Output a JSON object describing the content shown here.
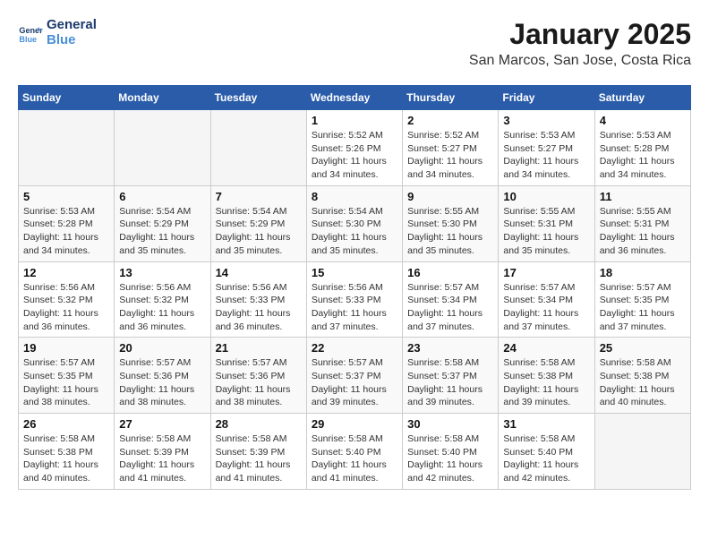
{
  "logo": {
    "line1": "General",
    "line2": "Blue"
  },
  "title": "January 2025",
  "subtitle": "San Marcos, San Jose, Costa Rica",
  "days_of_week": [
    "Sunday",
    "Monday",
    "Tuesday",
    "Wednesday",
    "Thursday",
    "Friday",
    "Saturday"
  ],
  "weeks": [
    [
      {
        "day": "",
        "sunrise": "",
        "sunset": "",
        "daylight": ""
      },
      {
        "day": "",
        "sunrise": "",
        "sunset": "",
        "daylight": ""
      },
      {
        "day": "",
        "sunrise": "",
        "sunset": "",
        "daylight": ""
      },
      {
        "day": "1",
        "sunrise": "Sunrise: 5:52 AM",
        "sunset": "Sunset: 5:26 PM",
        "daylight": "Daylight: 11 hours and 34 minutes."
      },
      {
        "day": "2",
        "sunrise": "Sunrise: 5:52 AM",
        "sunset": "Sunset: 5:27 PM",
        "daylight": "Daylight: 11 hours and 34 minutes."
      },
      {
        "day": "3",
        "sunrise": "Sunrise: 5:53 AM",
        "sunset": "Sunset: 5:27 PM",
        "daylight": "Daylight: 11 hours and 34 minutes."
      },
      {
        "day": "4",
        "sunrise": "Sunrise: 5:53 AM",
        "sunset": "Sunset: 5:28 PM",
        "daylight": "Daylight: 11 hours and 34 minutes."
      }
    ],
    [
      {
        "day": "5",
        "sunrise": "Sunrise: 5:53 AM",
        "sunset": "Sunset: 5:28 PM",
        "daylight": "Daylight: 11 hours and 34 minutes."
      },
      {
        "day": "6",
        "sunrise": "Sunrise: 5:54 AM",
        "sunset": "Sunset: 5:29 PM",
        "daylight": "Daylight: 11 hours and 35 minutes."
      },
      {
        "day": "7",
        "sunrise": "Sunrise: 5:54 AM",
        "sunset": "Sunset: 5:29 PM",
        "daylight": "Daylight: 11 hours and 35 minutes."
      },
      {
        "day": "8",
        "sunrise": "Sunrise: 5:54 AM",
        "sunset": "Sunset: 5:30 PM",
        "daylight": "Daylight: 11 hours and 35 minutes."
      },
      {
        "day": "9",
        "sunrise": "Sunrise: 5:55 AM",
        "sunset": "Sunset: 5:30 PM",
        "daylight": "Daylight: 11 hours and 35 minutes."
      },
      {
        "day": "10",
        "sunrise": "Sunrise: 5:55 AM",
        "sunset": "Sunset: 5:31 PM",
        "daylight": "Daylight: 11 hours and 35 minutes."
      },
      {
        "day": "11",
        "sunrise": "Sunrise: 5:55 AM",
        "sunset": "Sunset: 5:31 PM",
        "daylight": "Daylight: 11 hours and 36 minutes."
      }
    ],
    [
      {
        "day": "12",
        "sunrise": "Sunrise: 5:56 AM",
        "sunset": "Sunset: 5:32 PM",
        "daylight": "Daylight: 11 hours and 36 minutes."
      },
      {
        "day": "13",
        "sunrise": "Sunrise: 5:56 AM",
        "sunset": "Sunset: 5:32 PM",
        "daylight": "Daylight: 11 hours and 36 minutes."
      },
      {
        "day": "14",
        "sunrise": "Sunrise: 5:56 AM",
        "sunset": "Sunset: 5:33 PM",
        "daylight": "Daylight: 11 hours and 36 minutes."
      },
      {
        "day": "15",
        "sunrise": "Sunrise: 5:56 AM",
        "sunset": "Sunset: 5:33 PM",
        "daylight": "Daylight: 11 hours and 37 minutes."
      },
      {
        "day": "16",
        "sunrise": "Sunrise: 5:57 AM",
        "sunset": "Sunset: 5:34 PM",
        "daylight": "Daylight: 11 hours and 37 minutes."
      },
      {
        "day": "17",
        "sunrise": "Sunrise: 5:57 AM",
        "sunset": "Sunset: 5:34 PM",
        "daylight": "Daylight: 11 hours and 37 minutes."
      },
      {
        "day": "18",
        "sunrise": "Sunrise: 5:57 AM",
        "sunset": "Sunset: 5:35 PM",
        "daylight": "Daylight: 11 hours and 37 minutes."
      }
    ],
    [
      {
        "day": "19",
        "sunrise": "Sunrise: 5:57 AM",
        "sunset": "Sunset: 5:35 PM",
        "daylight": "Daylight: 11 hours and 38 minutes."
      },
      {
        "day": "20",
        "sunrise": "Sunrise: 5:57 AM",
        "sunset": "Sunset: 5:36 PM",
        "daylight": "Daylight: 11 hours and 38 minutes."
      },
      {
        "day": "21",
        "sunrise": "Sunrise: 5:57 AM",
        "sunset": "Sunset: 5:36 PM",
        "daylight": "Daylight: 11 hours and 38 minutes."
      },
      {
        "day": "22",
        "sunrise": "Sunrise: 5:57 AM",
        "sunset": "Sunset: 5:37 PM",
        "daylight": "Daylight: 11 hours and 39 minutes."
      },
      {
        "day": "23",
        "sunrise": "Sunrise: 5:58 AM",
        "sunset": "Sunset: 5:37 PM",
        "daylight": "Daylight: 11 hours and 39 minutes."
      },
      {
        "day": "24",
        "sunrise": "Sunrise: 5:58 AM",
        "sunset": "Sunset: 5:38 PM",
        "daylight": "Daylight: 11 hours and 39 minutes."
      },
      {
        "day": "25",
        "sunrise": "Sunrise: 5:58 AM",
        "sunset": "Sunset: 5:38 PM",
        "daylight": "Daylight: 11 hours and 40 minutes."
      }
    ],
    [
      {
        "day": "26",
        "sunrise": "Sunrise: 5:58 AM",
        "sunset": "Sunset: 5:38 PM",
        "daylight": "Daylight: 11 hours and 40 minutes."
      },
      {
        "day": "27",
        "sunrise": "Sunrise: 5:58 AM",
        "sunset": "Sunset: 5:39 PM",
        "daylight": "Daylight: 11 hours and 41 minutes."
      },
      {
        "day": "28",
        "sunrise": "Sunrise: 5:58 AM",
        "sunset": "Sunset: 5:39 PM",
        "daylight": "Daylight: 11 hours and 41 minutes."
      },
      {
        "day": "29",
        "sunrise": "Sunrise: 5:58 AM",
        "sunset": "Sunset: 5:40 PM",
        "daylight": "Daylight: 11 hours and 41 minutes."
      },
      {
        "day": "30",
        "sunrise": "Sunrise: 5:58 AM",
        "sunset": "Sunset: 5:40 PM",
        "daylight": "Daylight: 11 hours and 42 minutes."
      },
      {
        "day": "31",
        "sunrise": "Sunrise: 5:58 AM",
        "sunset": "Sunset: 5:40 PM",
        "daylight": "Daylight: 11 hours and 42 minutes."
      },
      {
        "day": "",
        "sunrise": "",
        "sunset": "",
        "daylight": ""
      }
    ]
  ]
}
